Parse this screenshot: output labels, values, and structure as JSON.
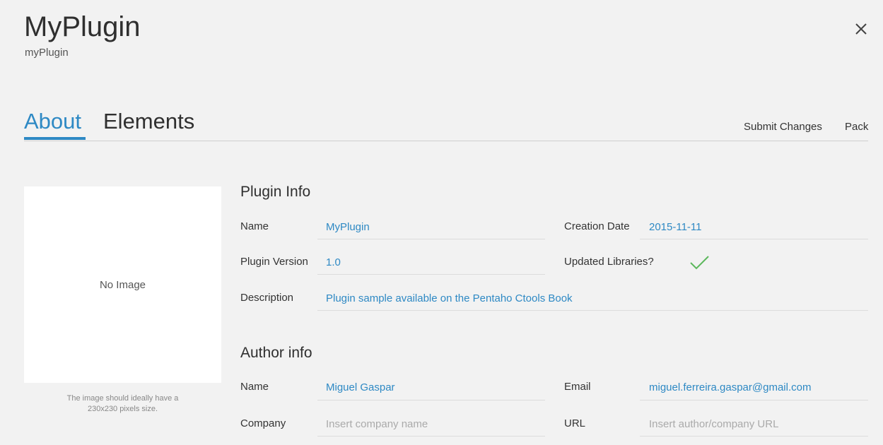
{
  "header": {
    "title": "MyPlugin",
    "subtitle": "myPlugin",
    "close_icon": "close-icon"
  },
  "tabs": [
    {
      "label": "About",
      "active": true
    },
    {
      "label": "Elements",
      "active": false
    }
  ],
  "actions": {
    "submit_label": "Submit Changes",
    "pack_label": "Pack"
  },
  "image": {
    "placeholder": "No Image",
    "hint_line1": "The image should ideally have a",
    "hint_line2": "230x230 pixels size."
  },
  "plugin_info": {
    "title": "Plugin Info",
    "name_label": "Name",
    "name_value": "MyPlugin",
    "creation_date_label": "Creation Date",
    "creation_date_value": "2015-11-11",
    "version_label": "Plugin Version",
    "version_value": "1.0",
    "updated_libraries_label": "Updated Libraries?",
    "updated_libraries_value": true,
    "description_label": "Description",
    "description_value": "Plugin sample available on the Pentaho Ctools Book"
  },
  "author_info": {
    "title": "Author info",
    "name_label": "Name",
    "name_value": "Miguel Gaspar",
    "email_label": "Email",
    "email_value": "miguel.ferreira.gaspar@gmail.com",
    "company_label": "Company",
    "company_placeholder": "Insert company name",
    "url_label": "URL",
    "url_placeholder": "Insert author/company URL"
  },
  "colors": {
    "accent": "#2e89c4",
    "check": "#5cb85c",
    "background": "#f2f2f2"
  }
}
